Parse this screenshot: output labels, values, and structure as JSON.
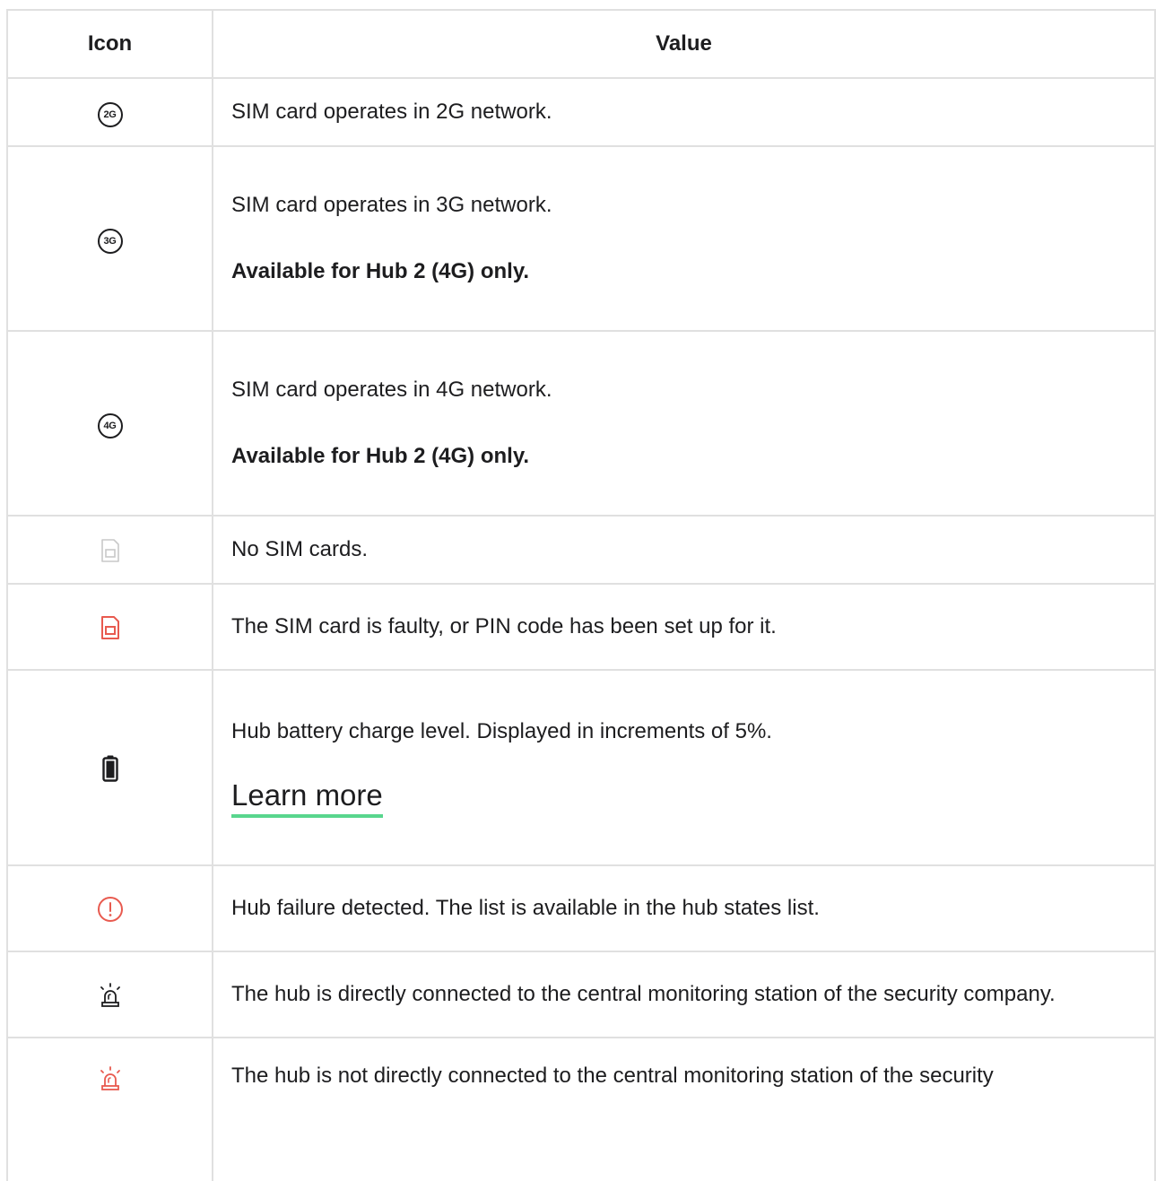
{
  "header": {
    "icon": "Icon",
    "value": "Value"
  },
  "rows": [
    {
      "icon": "network-2g-icon",
      "icon_text": "2G",
      "lines": [
        "SIM card operates in 2G network."
      ]
    },
    {
      "icon": "network-3g-icon",
      "icon_text": "3G",
      "lines": [
        "SIM card operates in 3G network."
      ],
      "bold": "Available for Hub 2 (4G) only."
    },
    {
      "icon": "network-4g-icon",
      "icon_text": "4G",
      "lines": [
        "SIM card operates in 4G network."
      ],
      "bold": "Available for Hub 2 (4G) only."
    },
    {
      "icon": "sim-card-empty-icon",
      "lines": [
        "No SIM cards."
      ]
    },
    {
      "icon": "sim-card-faulty-icon",
      "lines": [
        "The SIM card is faulty, or PIN code has been set up for it."
      ]
    },
    {
      "icon": "battery-icon",
      "lines": [
        "Hub battery charge level. Displayed in increments of 5%."
      ],
      "link": "Learn more"
    },
    {
      "icon": "alert-circle-icon",
      "lines": [
        "Hub failure detected. The list is available in the hub states list."
      ]
    },
    {
      "icon": "siren-connected-icon",
      "lines": [
        "The hub is directly connected to the central monitoring station of the security company."
      ]
    },
    {
      "icon": "siren-disconnected-icon",
      "lines": [
        "The hub is not directly connected to the central monitoring station of the security"
      ]
    }
  ],
  "colors": {
    "border": "#e0e0e0",
    "text": "#1d1d1f",
    "alert": "#e85a4f",
    "inactive": "#c8c8c8",
    "link_underline": "#58d68d"
  }
}
